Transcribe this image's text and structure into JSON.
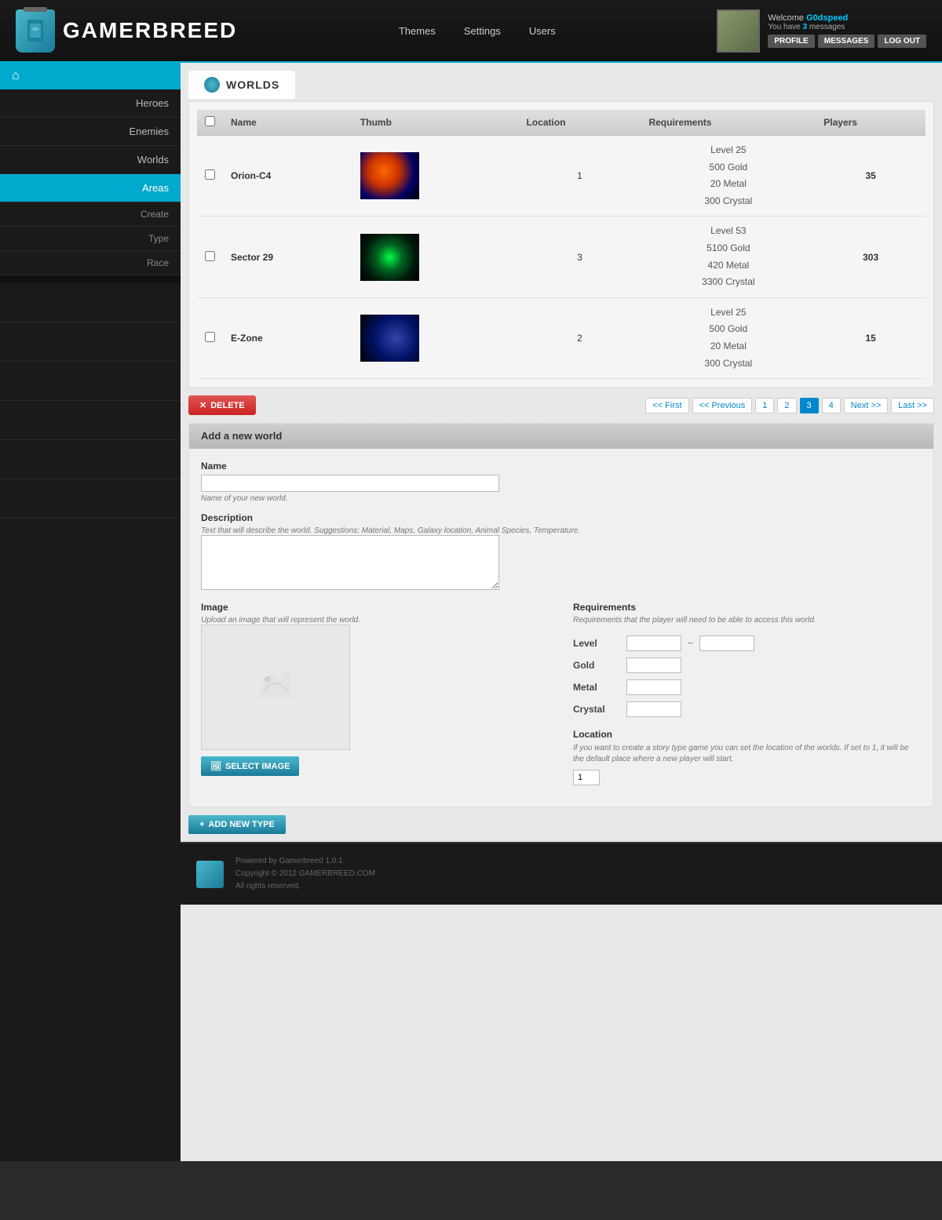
{
  "header": {
    "logo_text": "GAMERBREED",
    "nav": [
      {
        "label": "Themes"
      },
      {
        "label": "Settings"
      },
      {
        "label": "Users"
      }
    ],
    "user": {
      "welcome": "Welcome ",
      "username": "G0dspeed",
      "message_line": "You have ",
      "message_count": "3",
      "message_suffix": " messages",
      "btn_profile": "PROFILE",
      "btn_messages": "MESSAGES",
      "btn_logout": "LOG OUT"
    }
  },
  "sidebar": {
    "home_icon": "⌂",
    "items": [
      {
        "label": "Heroes",
        "active": false
      },
      {
        "label": "Enemies",
        "active": false
      },
      {
        "label": "Worlds",
        "active": false
      },
      {
        "label": "Areas",
        "active": true
      }
    ],
    "sub_items": [
      {
        "label": "Create"
      },
      {
        "label": "Type"
      },
      {
        "label": "Race"
      }
    ]
  },
  "page_tab": {
    "title": "WORLDS"
  },
  "table": {
    "headers": [
      "",
      "Name",
      "Thumb",
      "Location",
      "Requirements",
      "Players"
    ],
    "rows": [
      {
        "id": 1,
        "name": "Orion-C4",
        "location": "1",
        "requirements": "Level 25\n500 Gold\n20 Metal\n300 Crystal",
        "players": "35",
        "thumb_class": "thumb-orion"
      },
      {
        "id": 2,
        "name": "Sector 29",
        "location": "3",
        "requirements": "Level 53\n5100 Gold\n420 Metal\n3300 Crystal",
        "players": "303",
        "thumb_class": "thumb-sector"
      },
      {
        "id": 3,
        "name": "E-Zone",
        "location": "2",
        "requirements": "Level 25\n500 Gold\n20 Metal\n300 Crystal",
        "players": "15",
        "thumb_class": "thumb-ezone"
      }
    ]
  },
  "pagination": {
    "delete_label": "DELETE",
    "first": "<< First",
    "prev": "<< Previous",
    "pages": [
      "1",
      "2",
      "3",
      "4"
    ],
    "active_page": "3",
    "next": "Next >>",
    "last": "Last >>"
  },
  "form": {
    "header": "Add a new world",
    "name_label": "Name",
    "name_placeholder": "",
    "name_hint": "Name of your new world.",
    "desc_label": "Description",
    "desc_hint": "Text that will describe the world.",
    "desc_suggestions": "Suggestions: Material, Maps, Galaxy location, Animal Species, Temperature.",
    "image_label": "Image",
    "image_hint": "Upload an image that will represent the world.",
    "select_image_btn": "SELECT IMAGE",
    "req_label": "Requirements",
    "req_hint": "Requirements that the player will need to be able to access this world.",
    "level_label": "Level",
    "gold_label": "Gold",
    "metal_label": "Metal",
    "crystal_label": "Crystal",
    "location_label": "Location",
    "location_desc": "If you want to create a story type game you can set the location of the worlds. If set to 1, it will be the default place where a new player will start.",
    "location_default": "1",
    "add_type_btn": "ADD NEW TYPE"
  },
  "footer": {
    "powered_by": "Powered by Gamerbreed 1.0.1",
    "copyright": "Copyright © 2012 GAMERBREED.COM",
    "rights": "All rights reserved."
  }
}
